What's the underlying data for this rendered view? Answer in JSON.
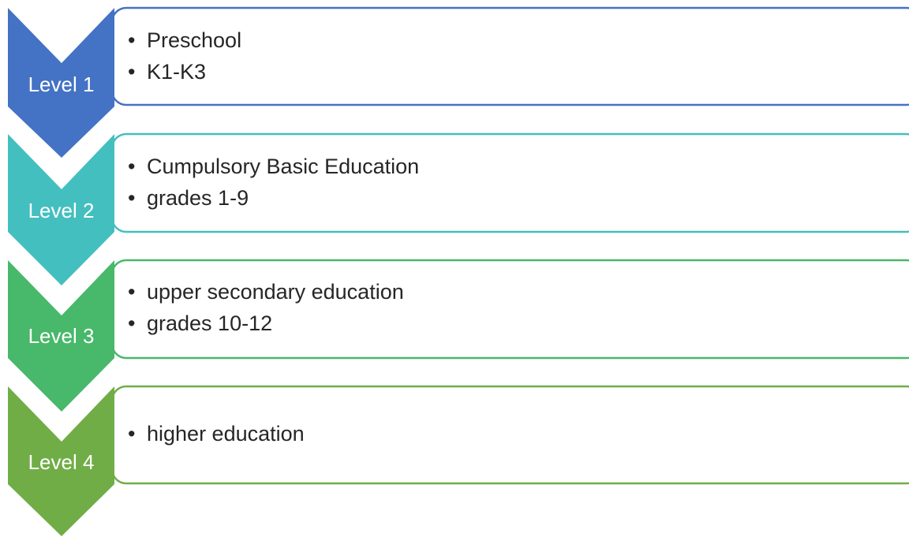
{
  "levels": [
    {
      "label": "Level 1",
      "color": "#4472C4",
      "items": [
        "Preschool",
        "K1-K3"
      ]
    },
    {
      "label": "Level 2",
      "color": "#44BFBF",
      "items": [
        "Cumpulsory Basic Education",
        "grades 1-9"
      ]
    },
    {
      "label": "Level 3",
      "color": "#48B86A",
      "items": [
        "upper secondary education",
        "grades 10-12"
      ]
    },
    {
      "label": "Level 4",
      "color": "#70AD47",
      "items": [
        "higher education"
      ]
    }
  ]
}
